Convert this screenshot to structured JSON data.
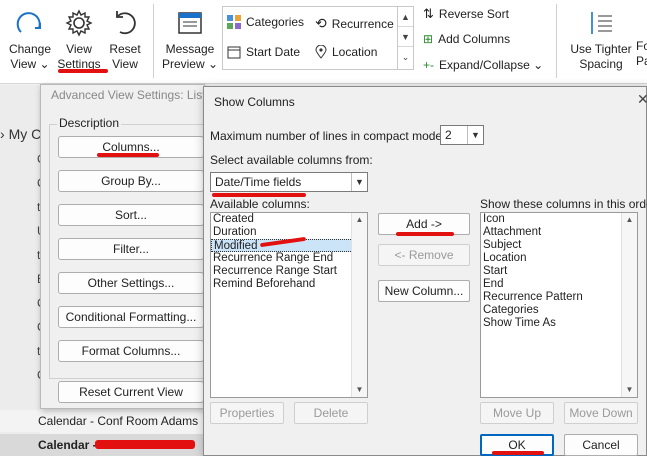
{
  "ribbon": {
    "change_view": [
      "Change",
      "View ⌄"
    ],
    "view_settings": [
      "View",
      "Settings"
    ],
    "reset_view": [
      "Reset",
      "View"
    ],
    "message_preview": [
      "Message",
      "Preview ⌄"
    ],
    "categories": "Categories",
    "recurrence": "Recurrence",
    "start_date": "Start Date",
    "location": "Location",
    "reverse_sort": "Reverse Sort",
    "add_columns": "Add Columns",
    "expand_collapse": "Expand/Collapse ⌄",
    "use_tighter_spacing": [
      "Use Tighter",
      "Spacing"
    ],
    "cut_off": [
      "Fo",
      "Pa"
    ]
  },
  "background": {
    "my_calendars_stub": "My C",
    "list_initials": [
      "C",
      "C",
      "t",
      "U",
      "t",
      "E",
      "C",
      "C",
      "t",
      "C"
    ],
    "calendar_rows": [
      "Calendar - Conf Room Adams",
      "Calendar - "
    ]
  },
  "advanced_view_settings": {
    "title": "Advanced View Settings: List",
    "description_label": "Description",
    "buttons": [
      "Columns...",
      "Group By...",
      "Sort...",
      "Filter...",
      "Other Settings...",
      "Conditional Formatting...",
      "Format Columns..."
    ],
    "reset_button": "Reset Current View"
  },
  "show_columns": {
    "title": "Show Columns",
    "close_glyph": "✕",
    "max_lines_label": "Maximum number of lines in compact mode:",
    "max_lines_value": "2",
    "select_from_label": "Select available columns from:",
    "select_from_value": "Date/Time fields",
    "available_label": "Available columns:",
    "available_items": [
      "Created",
      "Duration",
      "Modified",
      "Recurrence Range End",
      "Recurrence Range Start",
      "Remind Beforehand"
    ],
    "selected_available": "Modified",
    "shown_label": "Show these columns in this order:",
    "shown_items": [
      "Icon",
      "Attachment",
      "Subject",
      "Location",
      "Start",
      "End",
      "Recurrence Pattern",
      "Categories",
      "Show Time As"
    ],
    "add_button": "Add ->",
    "remove_button": "<- Remove",
    "new_column_button": "New Column...",
    "properties_button": "Properties",
    "delete_button": "Delete",
    "move_up_button": "Move Up",
    "move_down_button": "Move Down",
    "ok_button": "OK",
    "cancel_button": "Cancel"
  },
  "colors": {
    "accent": "#0067c0",
    "annotation": "#e31010",
    "selection": "#cce4f7"
  }
}
